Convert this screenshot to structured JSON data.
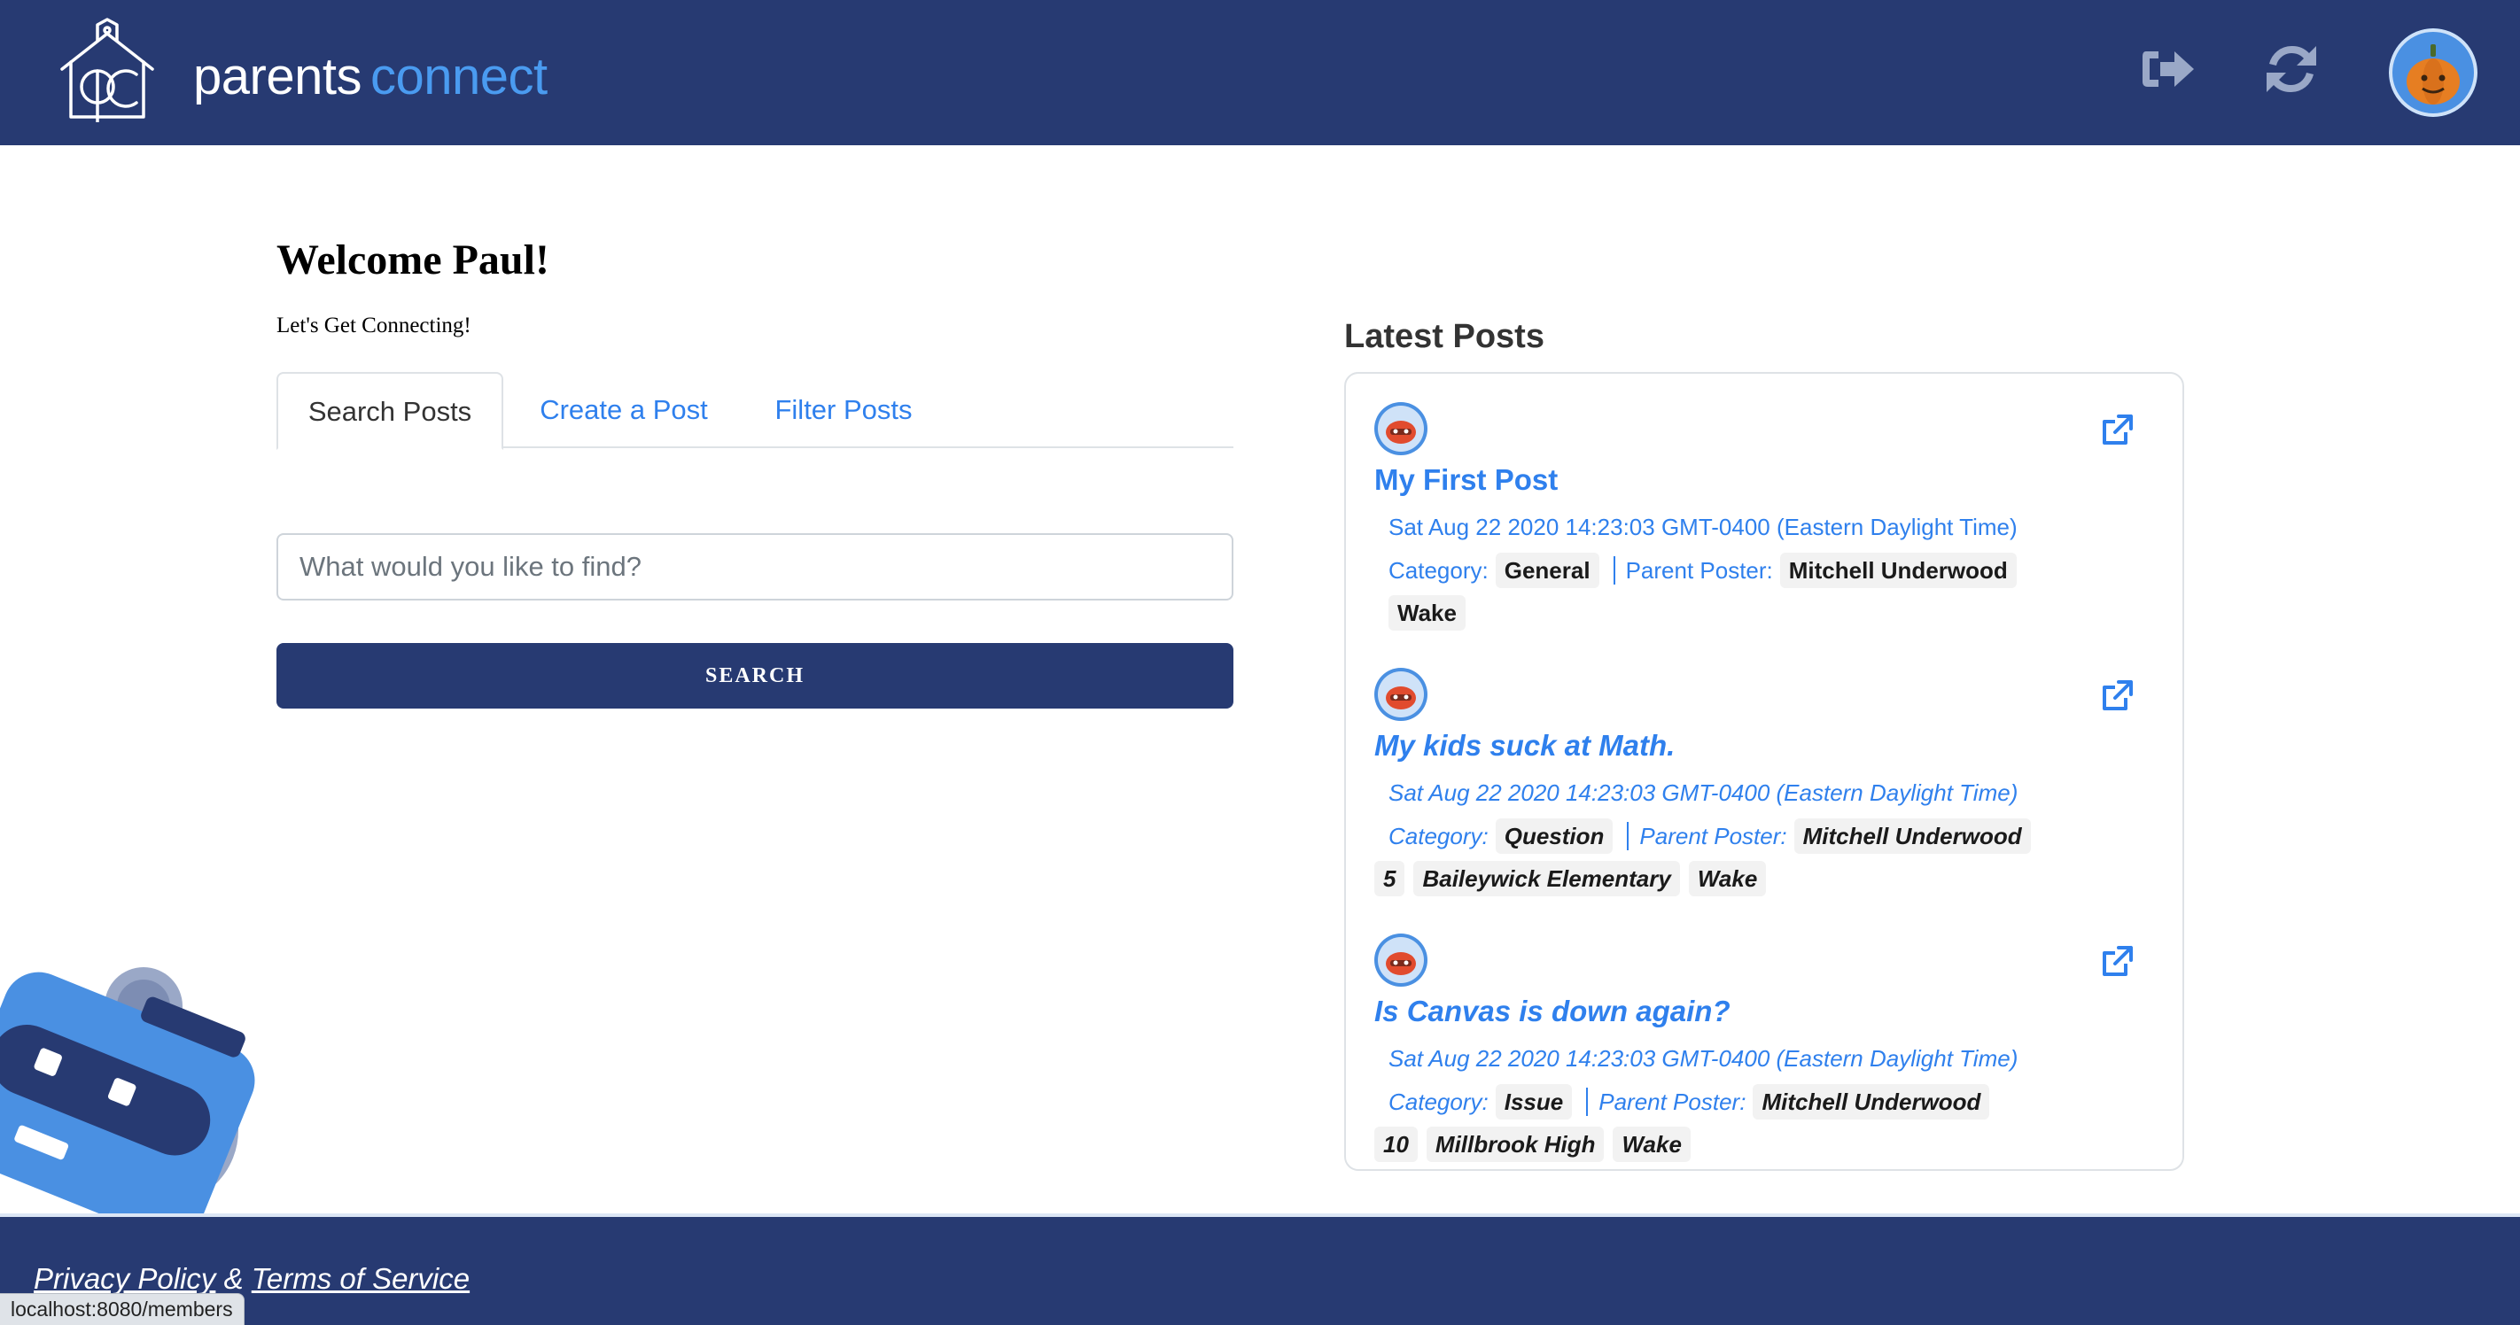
{
  "header": {
    "brand_part1": "parents",
    "brand_part2": "connect",
    "logo_icon": "schoolhouse-pc-logo",
    "actions": [
      {
        "name": "logout",
        "icon": "sign-out-icon"
      },
      {
        "name": "refresh",
        "icon": "sync-icon"
      },
      {
        "name": "profile",
        "icon": "pumpkin-avatar"
      }
    ]
  },
  "welcome": {
    "title": "Welcome Paul!",
    "subtitle": "Let's Get Connecting!"
  },
  "tabs": [
    {
      "label": "Search Posts",
      "active": true
    },
    {
      "label": "Create a Post",
      "active": false
    },
    {
      "label": "Filter Posts",
      "active": false
    }
  ],
  "search": {
    "placeholder": "What would you like to find?",
    "value": "",
    "button_label": "SEARCH"
  },
  "latest": {
    "title": "Latest Posts",
    "category_label": "Category:",
    "poster_label": "Parent Poster:",
    "posts": [
      {
        "title": "My First Post",
        "date": "Sat Aug 22 2020 14:23:03 GMT-0400 (Eastern Daylight Time)",
        "category": "General",
        "poster": "Mitchell Underwood",
        "tags": [
          "Wake"
        ]
      },
      {
        "title": "My kids suck at Math.",
        "date": "Sat Aug 22 2020 14:23:03 GMT-0400 (Eastern Daylight Time)",
        "category": "Question",
        "poster": "Mitchell Underwood",
        "tags": [
          "5",
          "Baileywick Elementary",
          "Wake"
        ]
      },
      {
        "title": "Is Canvas is down again?",
        "date": "Sat Aug 22 2020 14:23:03 GMT-0400 (Eastern Daylight Time)",
        "category": "Issue",
        "poster": "Mitchell Underwood",
        "tags": [
          "10",
          "Millbrook High",
          "Wake"
        ]
      }
    ]
  },
  "footer": {
    "privacy": "Privacy Policy",
    "amp": "&",
    "terms": "Terms of Service"
  },
  "status_bar": {
    "url": "localhost:8080/members"
  },
  "colors": {
    "navy": "#273a72",
    "accent_blue": "#2f80ed",
    "brand_blue": "#4a9bf0"
  }
}
